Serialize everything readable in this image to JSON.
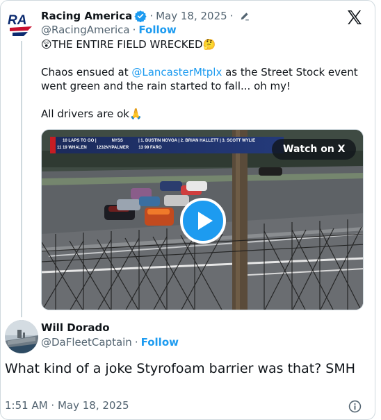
{
  "post": {
    "author_name": "Racing America",
    "date": "May 18, 2025",
    "handle": "@RacingAmerica",
    "follow_label": "Follow",
    "line1_emoji_left": "😲",
    "line1": "THE ENTIRE FIELD WRECKED",
    "line1_emoji_right": "🤔",
    "line2_prefix": "Chaos ensued at ",
    "line2_mention": "@LancasterMtplx",
    "line2_suffix": " as the Street Stock event went green and the rain started to fall... oh my!",
    "line3": "All drivers are ok",
    "line3_emoji": "🙏",
    "avatar_text": "RA"
  },
  "video": {
    "watch_label": "Watch on X",
    "overlay_row1": [
      "10 LAPS TO GO |",
      "NYSS",
      "| 1. DUSTIN NOVOA | 2. BRIAN HALLETT | 3. SCOTT WYLIE"
    ],
    "overlay_row2": [
      "11  19  WHALEN",
      "1232NYPALMER",
      "13  99  FARO"
    ]
  },
  "reply": {
    "author_name": "Will Dorado",
    "handle": "@DaFleetCaptain",
    "follow_label": "Follow",
    "text": "What kind of a joke Styrofoam barrier was that? SMH",
    "timestamp": "1:51 AM · May 18, 2025"
  },
  "colors": {
    "link": "#1d9bf0",
    "muted": "#536471",
    "text": "#0f1419",
    "border": "#cfd9de",
    "brand_red": "#c8102e",
    "brand_navy": "#0b2a6f"
  },
  "icons": [
    "x-logo-icon",
    "verified-badge-icon",
    "edit-pencil-icon",
    "play-icon",
    "info-icon"
  ]
}
